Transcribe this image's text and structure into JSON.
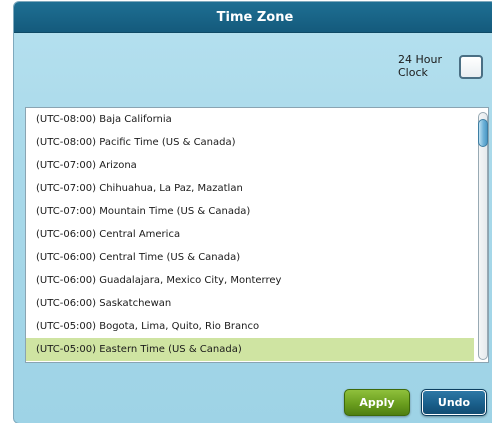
{
  "dialog": {
    "title": "Time Zone"
  },
  "clock": {
    "label_line1": "24 Hour",
    "label_line2": "Clock",
    "checked": false
  },
  "timezones": {
    "items": [
      "(UTC-08:00) Baja California",
      "(UTC-08:00) Pacific Time (US & Canada)",
      "(UTC-07:00) Arizona",
      "(UTC-07:00) Chihuahua, La Paz, Mazatlan",
      "(UTC-07:00) Mountain Time (US & Canada)",
      "(UTC-06:00) Central America",
      "(UTC-06:00) Central Time (US & Canada)",
      "(UTC-06:00) Guadalajara, Mexico City, Monterrey",
      "(UTC-06:00) Saskatchewan",
      "(UTC-05:00) Bogota, Lima, Quito, Rio Branco",
      "(UTC-05:00) Eastern Time (US & Canada)"
    ],
    "selected": "(UTC-05:00) Eastern Time (US & Canada)"
  },
  "buttons": {
    "apply_label": "Apply",
    "undo_label": "Undo"
  },
  "colors": {
    "title_bar": "#1a6488",
    "dialog_bg": "#a9d9ea",
    "selected_row": "#cfe4a2",
    "apply": "#6a9e1e",
    "undo": "#1a5f8b"
  }
}
